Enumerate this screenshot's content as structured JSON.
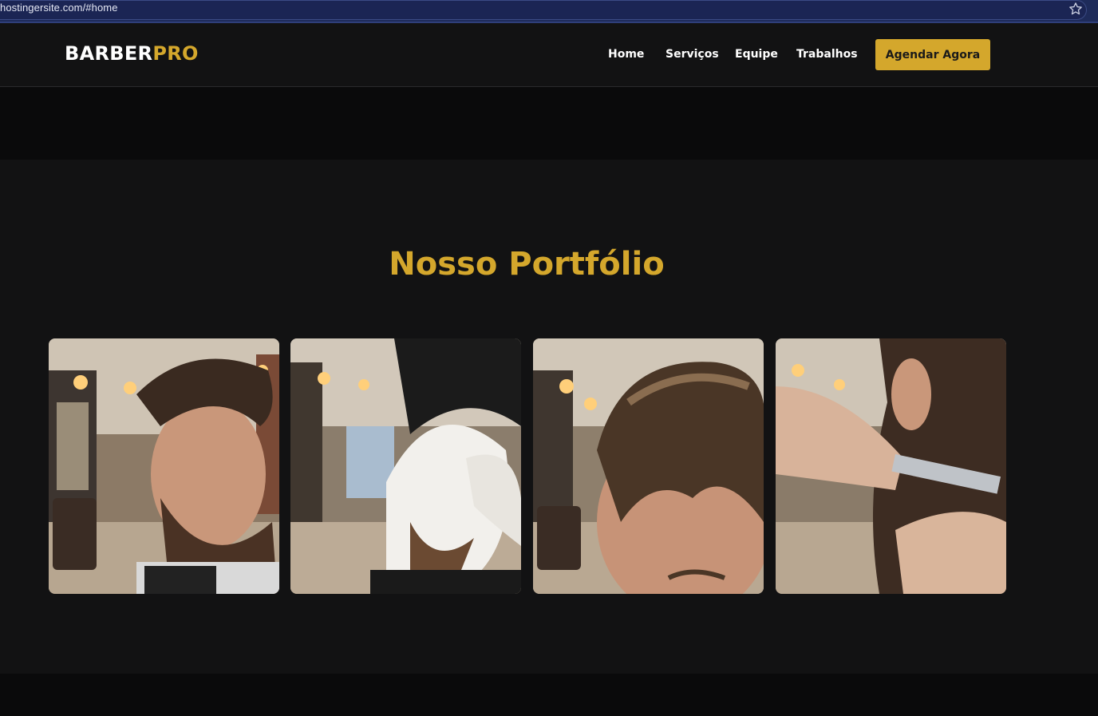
{
  "browser": {
    "url": "hostingersite.com/#home"
  },
  "header": {
    "logo_primary": "BARBER",
    "logo_accent": "PRO",
    "nav": [
      {
        "label": "Home"
      },
      {
        "label": "Serviços"
      },
      {
        "label": "Equipe"
      },
      {
        "label": "Trabalhos"
      }
    ],
    "cta_label": "Agendar Agora"
  },
  "portfolio": {
    "title": "Nosso Portfólio",
    "items": [
      {
        "subject": "side-part fade haircut with beard"
      },
      {
        "subject": "hot towel shave service"
      },
      {
        "subject": "pompadour hairstyle close-up"
      },
      {
        "subject": "straight razor neck shave"
      }
    ]
  },
  "colors": {
    "accent": "#d4a72c",
    "background": "#121213",
    "header": "#121213",
    "text": "#ffffff"
  },
  "icons": [
    "star-icon"
  ]
}
